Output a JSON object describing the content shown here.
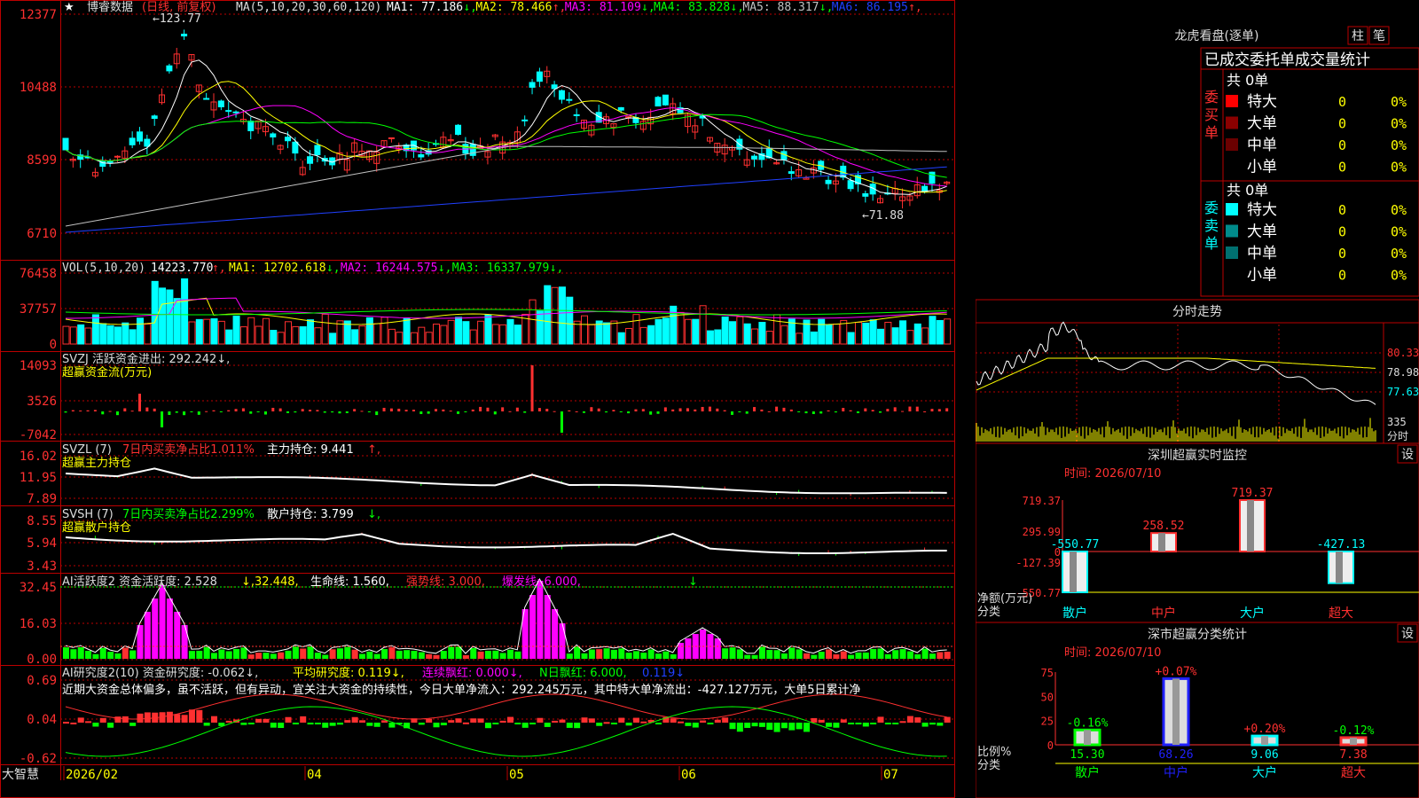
{
  "colors": {
    "up": "#ff3030",
    "down": "#00ffff",
    "grid": "#b00000",
    "white": "#ffffff",
    "yellow": "#ffff00",
    "magenta": "#ff00ff",
    "green": "#00ff00",
    "gray": "#c0c0c0",
    "blue": "#2040ff",
    "cyan": "#00ffff"
  },
  "price_panel": {
    "star": "★",
    "stock_name": "博睿数据",
    "period": "(日线, 前复权)",
    "ma_params": "MA(5,10,20,30,60,120)",
    "mas": [
      {
        "label": "MA1: 77.186",
        "arrow": "↓",
        "color": "#ffffff"
      },
      {
        "label": "MA2: 78.466",
        "arrow": "↑",
        "color": "#ffff00"
      },
      {
        "label": "MA3: 81.109",
        "arrow": "↓",
        "color": "#ff00ff"
      },
      {
        "label": "MA4: 83.828",
        "arrow": "↓",
        "color": "#00ff00"
      },
      {
        "label": "MA5: 88.317",
        "arrow": "↓",
        "color": "#c0c0c0"
      },
      {
        "label": "MA6: 86.195",
        "arrow": "↑",
        "color": "#2040ff"
      }
    ],
    "y_labels": [
      "12377",
      "10488",
      "8599",
      "6710"
    ],
    "high_label": "←123.77",
    "low_label": "←71.88"
  },
  "vol_panel": {
    "title": "VOL(5,10,20)",
    "value": "14223.770",
    "mas": [
      {
        "label": "MA1: 12702.618",
        "arrow": "↓",
        "color": "#ffff00"
      },
      {
        "label": "MA2: 16244.575",
        "arrow": "↓",
        "color": "#ff00ff"
      },
      {
        "label": "MA3: 16337.979",
        "arrow": "↓",
        "color": "#00ff00"
      }
    ],
    "y_labels": [
      "76458",
      "37757",
      "0"
    ]
  },
  "svzj_panel": {
    "title": "SVZJ  活跃资金进出: 292.242↓,",
    "subtitle": "超赢资金流(万元)",
    "y_labels": [
      "14093",
      "3526",
      "-7042"
    ]
  },
  "svzl_panel": {
    "title": "SVZL (7)",
    "red_text": "7日内买卖净占比1.011%",
    "white_text": "主力持仓: 9.441",
    "arrow": "↑,",
    "subtitle": "超赢主力持仓",
    "y_labels": [
      "16.02",
      "11.95",
      "7.89"
    ]
  },
  "svsh_panel": {
    "title": "SVSH (7)",
    "green_text": "7日内买卖净占比2.299%",
    "white_text": "散户持仓: 3.799",
    "arrow": "↓,",
    "subtitle": "超赢散户持仓",
    "y_labels": [
      "8.55",
      "5.94",
      "3.43"
    ]
  },
  "ai_active_panel": {
    "title": "AI活跃度2 资金活跃度: 2.528",
    "v2": "↓,32.448,",
    "v3": "生命线: 1.560,",
    "v4": "强势线: 3.000,",
    "v5": "爆发线: 6.000,",
    "y_labels": [
      "32.45",
      "16.03",
      "0.00"
    ]
  },
  "ai_research_panel": {
    "title": "AI研究度2(10) 资金研究度: -0.062↓,",
    "avg": "平均研究度: 0.119↓,",
    "red": "连续飘红: 0.000↓,",
    "nred": "N日飘红: 6.000,",
    "val": "0.119↓",
    "comment": "近期大资金总体偏多，虽不活跃，但有异动，宜关注大资金的持续性，今日大单净流入：292.245万元，其中特大单净流出：-427.127万元，大单5日累计净",
    "y_labels": [
      "0.69",
      "0.04",
      "-0.62"
    ]
  },
  "bottom_axis": {
    "brand": "大智慧",
    "dates": [
      "2026/02",
      "04",
      "05",
      "06",
      "07"
    ]
  },
  "dragon_tiger": {
    "title": "龙虎看盘(逐单)",
    "tabs": [
      "柱",
      "笔"
    ],
    "header": "已成交委托单成交量统计",
    "buy_label": "委买单",
    "sell_label": "委卖单",
    "buy_total": "共 0单",
    "sell_total": "共 0单",
    "buy_rows": [
      {
        "name": "特大",
        "value": "0",
        "pct": "0%",
        "color": "#ff0000"
      },
      {
        "name": "大单",
        "value": "0",
        "pct": "0%",
        "color": "#8b0000"
      },
      {
        "name": "中单",
        "value": "0",
        "pct": "0%",
        "color": "#6b0000"
      },
      {
        "name": "小单",
        "value": "0",
        "pct": "0%",
        "color": ""
      }
    ],
    "sell_rows": [
      {
        "name": "特大",
        "value": "0",
        "pct": "0%",
        "color": "#00ffff"
      },
      {
        "name": "大单",
        "value": "0",
        "pct": "0%",
        "color": "#008b8b"
      },
      {
        "name": "中单",
        "value": "0",
        "pct": "0%",
        "color": "#007070"
      },
      {
        "name": "小单",
        "value": "0",
        "pct": "0%",
        "color": ""
      }
    ]
  },
  "intraday": {
    "title": "分时走势",
    "labels": [
      "80.33",
      "78.98",
      "77.63",
      "335",
      "分时"
    ]
  },
  "monitor": {
    "title": "深圳超赢实时监控",
    "settings": "设",
    "time": "时间: 2026/07/10",
    "y_labels": [
      "719.37",
      "295.99",
      "0",
      "-127.39",
      "-550.77"
    ],
    "net_label": "净额(万元)",
    "cls_label": "分类",
    "bars": [
      {
        "cat": "散户",
        "value": -550.77,
        "label": "-550.77"
      },
      {
        "cat": "中户",
        "value": 258.52,
        "label": "258.52"
      },
      {
        "cat": "大户",
        "value": 719.37,
        "label": "719.37"
      },
      {
        "cat": "超大",
        "value": -427.13,
        "label": "-427.13"
      }
    ]
  },
  "classify": {
    "title": "深市超赢分类统计",
    "settings": "设",
    "time": "时间: 2026/07/10",
    "y_labels": [
      "75",
      "50",
      "25",
      "0"
    ],
    "ratio_label": "比例%",
    "cls_label": "分类",
    "bars": [
      {
        "cat": "散户",
        "value": 15.3,
        "label": "15.30",
        "change": "-0.16%"
      },
      {
        "cat": "中户",
        "value": 68.26,
        "label": "68.26",
        "change": "+0.07%"
      },
      {
        "cat": "大户",
        "value": 9.06,
        "label": "9.06",
        "change": "+0.20%"
      },
      {
        "cat": "超大",
        "value": 7.38,
        "label": "7.38",
        "change": "-0.12%"
      }
    ]
  }
}
